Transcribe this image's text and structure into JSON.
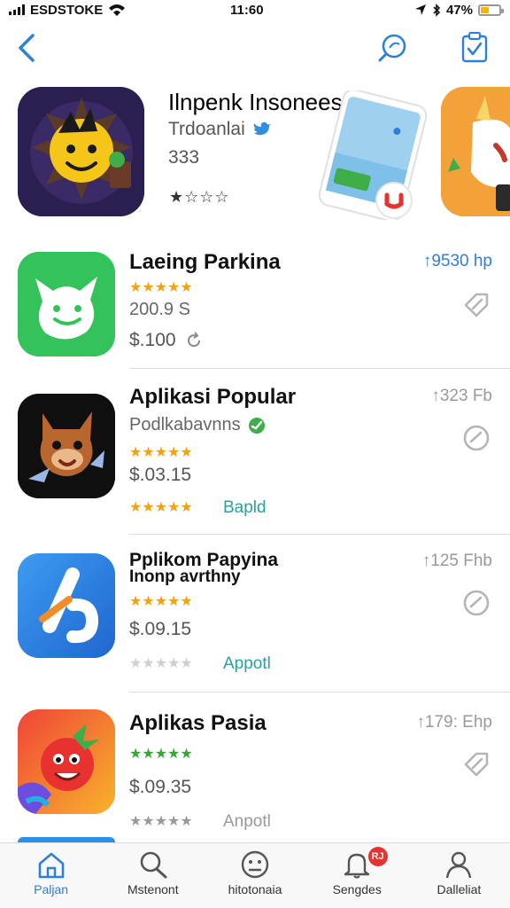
{
  "status_bar": {
    "carrier": "ESDSTOKE",
    "time": "11:60",
    "battery": "47%",
    "battery_level": 0.47
  },
  "nav": {
    "back_icon": "chevron-left-icon",
    "search_icon": "search-icon",
    "clipboard_icon": "clipboard-check-icon"
  },
  "featured": {
    "title": "Ilnpenk Insoneesam",
    "developer": "Trdoanlai",
    "count": "333",
    "stars": "★☆☆☆"
  },
  "apps": [
    {
      "name": "Laeing Parkina",
      "subtitle": "200.9 S",
      "stars": "★★★★★",
      "price": "$.100",
      "size": "↑9530 hp"
    },
    {
      "name": "Aplikasi Popular",
      "subtitle": "Podlkabavnns",
      "stars": "★★★★★",
      "price": "$.03.15",
      "stars2": "★★★★★",
      "link": "Bapld",
      "size": "↑323 Fb"
    },
    {
      "name": "Pplikom Papyina",
      "name2": "Inonp avrthny",
      "stars": "★★★★★",
      "price": "$.09.15",
      "stars2": "★★★★★",
      "link": "Appotl",
      "size": "↑125 Fhb"
    },
    {
      "name": "Aplikas Pasia",
      "stars": "★★★★★",
      "price": "$.09.35",
      "stars2": "★★★★★",
      "link": "Anpotl",
      "size": "↑179: Ehp"
    }
  ],
  "tabs": [
    {
      "label": "Paljan",
      "icon": "house-icon",
      "active": true
    },
    {
      "label": "Mstenont",
      "icon": "search-icon"
    },
    {
      "label": "hitotonaia",
      "icon": "face-icon"
    },
    {
      "label": "Sengdes",
      "icon": "bell-icon",
      "badge": "RJ"
    },
    {
      "label": "Dalleliat",
      "icon": "person-icon"
    }
  ],
  "colors": {
    "accent": "#2f7fd8",
    "star": "#f2a30f",
    "link": "#2aa198",
    "badge": "#e8322f"
  }
}
